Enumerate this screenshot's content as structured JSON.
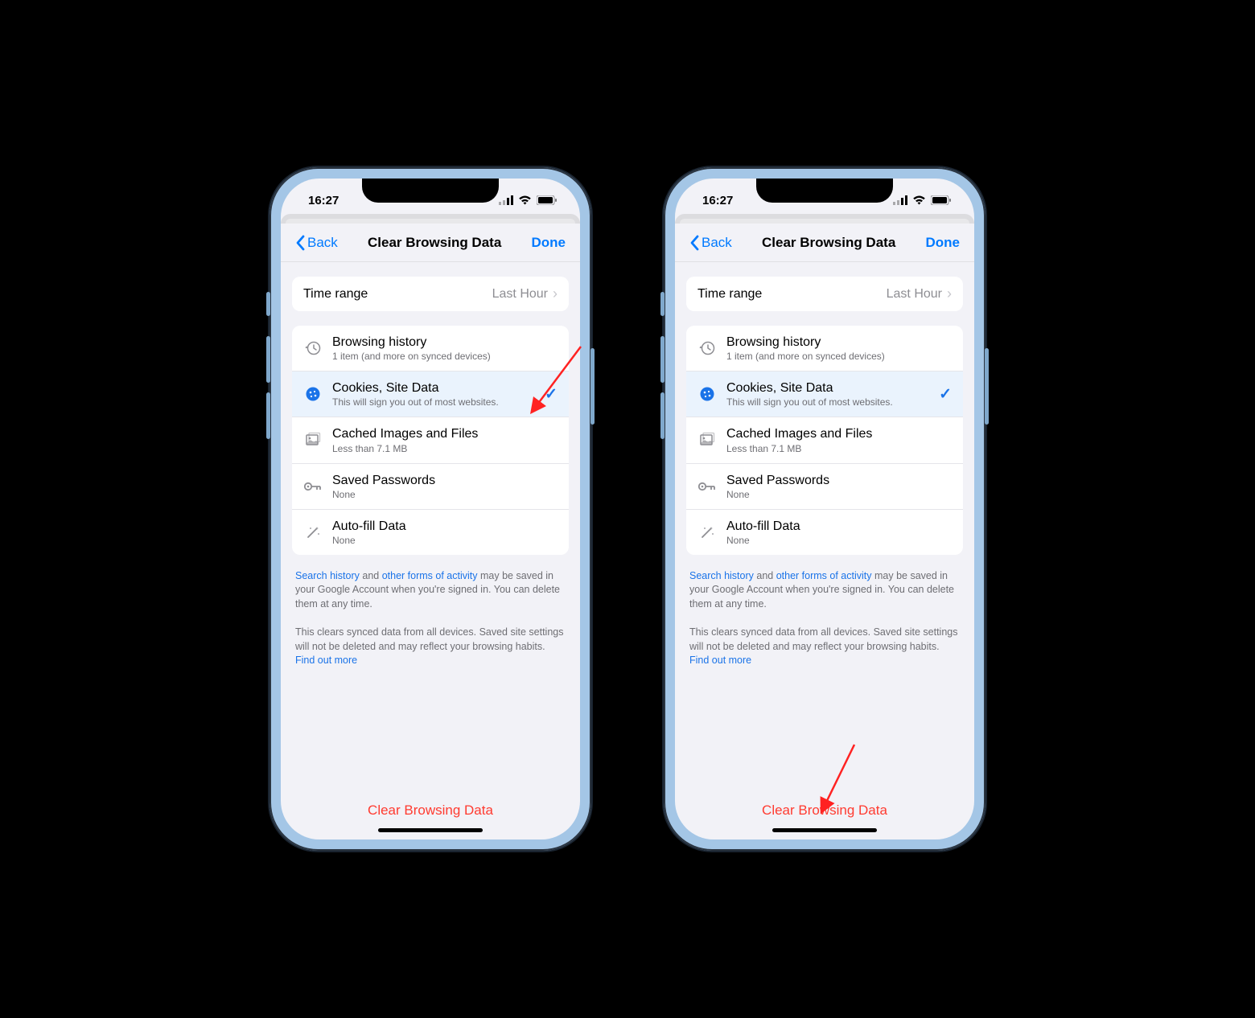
{
  "status": {
    "time": "16:27"
  },
  "nav": {
    "back": "Back",
    "title": "Clear Browsing Data",
    "done": "Done"
  },
  "timeRange": {
    "label": "Time range",
    "value": "Last Hour"
  },
  "items": [
    {
      "title": "Browsing history",
      "sub": "1 item (and more on synced devices)",
      "checked": false
    },
    {
      "title": "Cookies, Site Data",
      "sub": "This will sign you out of most websites.",
      "checked": true
    },
    {
      "title": "Cached Images and Files",
      "sub": "Less than 7.1 MB",
      "checked": false
    },
    {
      "title": "Saved Passwords",
      "sub": "None",
      "checked": false
    },
    {
      "title": "Auto-fill Data",
      "sub": "None",
      "checked": false
    }
  ],
  "footer1": {
    "link1": "Search history",
    "mid1": " and ",
    "link2": "other forms of activity",
    "rest": " may be saved in your Google Account when you're signed in. You can delete them at any time."
  },
  "footer2": {
    "text": "This clears synced data from all devices. Saved site settings will not be deleted and may reflect your browsing habits. ",
    "link": "Find out more"
  },
  "clearBtn": "Clear Browsing Data"
}
